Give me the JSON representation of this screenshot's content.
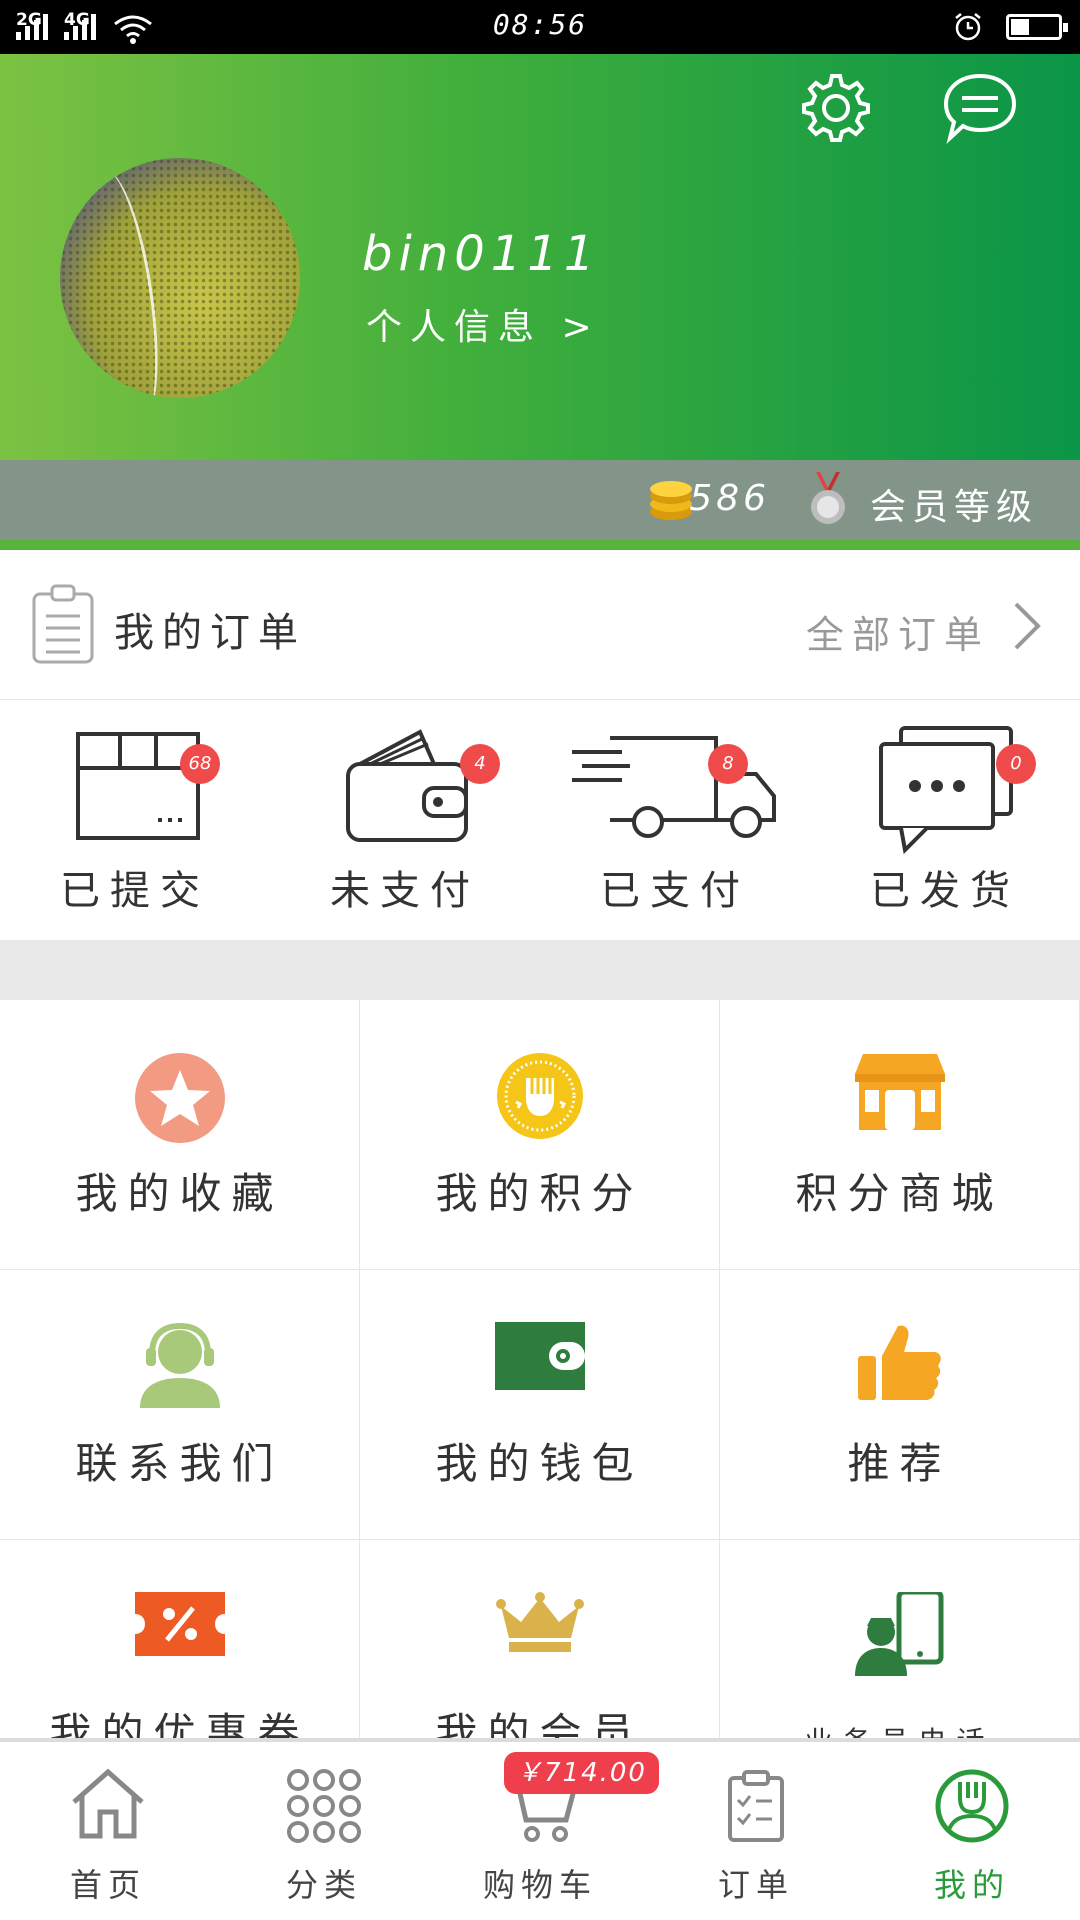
{
  "status_bar": {
    "network_1": "2G",
    "network_2": "4G",
    "time": "08:56"
  },
  "profile": {
    "username": "bin0111",
    "info_link": "个人信息 >",
    "points": "586",
    "level_label": "会员等级"
  },
  "orders": {
    "title": "我的订单",
    "all_link": "全部订单",
    "statuses": [
      {
        "label": "已提交",
        "count": "68"
      },
      {
        "label": "未支付",
        "count": "4"
      },
      {
        "label": "已支付",
        "count": "8"
      },
      {
        "label": "已发货",
        "count": "0"
      }
    ]
  },
  "grid": {
    "items": [
      {
        "label": "我的收藏",
        "icon": "star-icon",
        "color": "#f29a82"
      },
      {
        "label": "我的积分",
        "icon": "points-badge-icon",
        "color": "#f5c518"
      },
      {
        "label": "积分商城",
        "icon": "store-icon",
        "color": "#f5a623"
      },
      {
        "label": "联系我们",
        "icon": "support-agent-icon",
        "color": "#a8c97a"
      },
      {
        "label": "我的钱包",
        "icon": "wallet-icon",
        "color": "#2f7d3e"
      },
      {
        "label": "推荐",
        "icon": "thumbs-up-icon",
        "color": "#f5a623"
      },
      {
        "label": "我的优惠券",
        "icon": "coupon-icon",
        "color": "#ee5a24"
      },
      {
        "label": "我的会员",
        "icon": "crown-icon",
        "color": "#d9b24c"
      },
      {
        "label": "业务员电话",
        "icon": "salesman-phone-icon",
        "color": "#2f7d3e"
      }
    ]
  },
  "tabbar": {
    "tabs": [
      {
        "label": "首页",
        "icon": "home-icon"
      },
      {
        "label": "分类",
        "icon": "grid-dots-icon"
      },
      {
        "label": "购物车",
        "icon": "cart-icon"
      },
      {
        "label": "订单",
        "icon": "clipboard-check-icon"
      },
      {
        "label": "我的",
        "icon": "user-fork-icon"
      }
    ],
    "cart_total": "￥714.00",
    "active": "我的"
  },
  "colors": {
    "brand_green": "#0a9547",
    "accent_green": "#7cc242",
    "badge_red": "#f04b4b"
  }
}
